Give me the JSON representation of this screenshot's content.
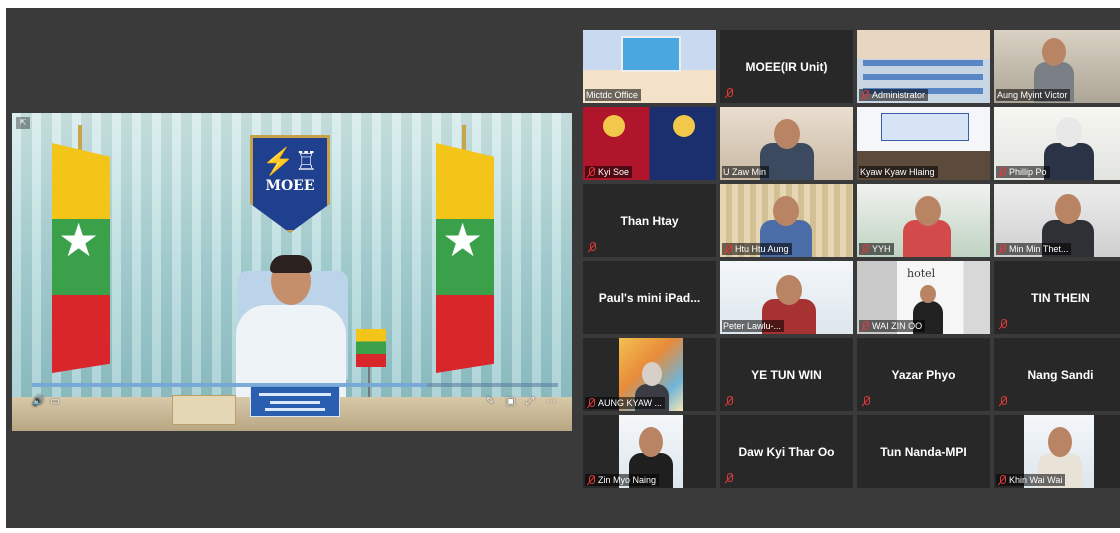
{
  "speaker": {
    "emblem_text": "MOEE",
    "controls": {
      "volume_icon": "volume-icon",
      "captions_icon": "captions-icon",
      "pen_icon": "pen-icon",
      "expand_icon": "expand-icon",
      "more_icon": "more-icon"
    },
    "progress": 0.75
  },
  "gallery": [
    {
      "name": "Mictdc Office",
      "video": true,
      "active": true
    },
    {
      "name": "MOEE(IR Unit)",
      "video": false
    },
    {
      "name": "Administrator",
      "video": true
    },
    {
      "name": "Aung Myint Victor",
      "video": true
    },
    {
      "name": "Kyi Soe",
      "video": true
    },
    {
      "name": "U Zaw Min",
      "video": true
    },
    {
      "name": "Kyaw Kyaw Hlaing",
      "video": true
    },
    {
      "name": "Phillip Po",
      "video": true
    },
    {
      "name": "Than Htay",
      "video": false
    },
    {
      "name": "Htu Htu Aung",
      "video": true
    },
    {
      "name": "YYH",
      "video": true
    },
    {
      "name": "Min Min Thet...",
      "video": true
    },
    {
      "name": "Paul's mini iPad...",
      "video": false
    },
    {
      "name": "Peter Lawlu-...",
      "video": true
    },
    {
      "name": "WAI ZIN OO",
      "video": true
    },
    {
      "name": "TIN THEIN",
      "video": false
    },
    {
      "name": "AUNG KYAW ...",
      "video": true
    },
    {
      "name": "YE TUN WIN",
      "video": false
    },
    {
      "name": "Yazar Phyo",
      "video": false
    },
    {
      "name": "Nang Sandi",
      "video": false
    },
    {
      "name": "Zin Myo Naing",
      "video": true
    },
    {
      "name": "Daw Kyi Thar Oo",
      "video": false
    },
    {
      "name": "Tun Nanda-MPI",
      "video": false
    },
    {
      "name": "Khin Wai Wai",
      "video": true
    }
  ],
  "colors": {
    "background": "#3a3a3a",
    "tile": "#282828",
    "active_outline": "#d6c84a",
    "muted_mic": "#e03a3a"
  }
}
